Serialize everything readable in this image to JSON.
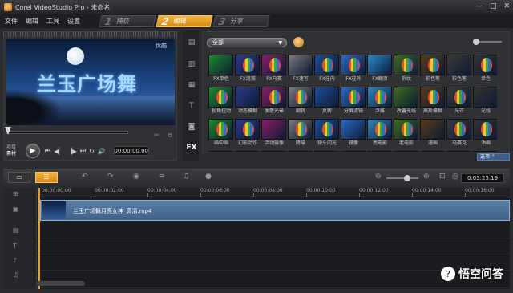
{
  "window": {
    "title": "Corel VideoStudio Pro - 未命名",
    "controls": [
      "—",
      "□",
      "✕"
    ]
  },
  "menu": [
    "文件",
    "编辑",
    "工具",
    "设置"
  ],
  "steps": [
    {
      "num": "1",
      "label": "捕获",
      "active": false
    },
    {
      "num": "2",
      "label": "编辑",
      "active": true
    },
    {
      "num": "3",
      "label": "分享",
      "active": false
    }
  ],
  "preview": {
    "overlay_title": "兰玉广场舞",
    "corner_logo": "优酷",
    "mode_labels": [
      "项目",
      "素材"
    ],
    "timecode": "00:00:00.00"
  },
  "library": {
    "dropdown": "全部",
    "options_label": "选项",
    "fx_label": "FX",
    "thumbnails": [
      "FX单色",
      "FX涟漪",
      "FX马赛",
      "FX速写",
      "FX往内",
      "FX往外",
      "FX翻页",
      "折纹",
      "彩色笔",
      "彩色笔",
      "单色",
      "视角扭动",
      "动态模糊",
      "发散光晕",
      "翻转",
      "反转",
      "分屏滤镜",
      "浮雕",
      "改善光线",
      "高斯模糊",
      "光芒",
      "光线",
      "画中画",
      "幻影动作",
      "活动摄像",
      "降噪",
      "镜头闪光",
      "镜像",
      "亮电影",
      "老电影",
      "漫画",
      "马赛克",
      "油画",
      "",
      "",
      "",
      "",
      "",
      "",
      "",
      "",
      "",
      "",
      ""
    ]
  },
  "timeline": {
    "project_timecode": "0:03:25.19",
    "ruler": [
      "00:00:00:00",
      "00:00:02:00",
      "00:00:04:00",
      "00:00:06:00",
      "00:00:08:00",
      "00:00:10:00",
      "00:00:12:00",
      "00:00:14:00",
      "00:00:16:00"
    ],
    "clip_name": "兰玉广场舞月亮女神_高清.mp4"
  },
  "watermark": "悟空问答"
}
